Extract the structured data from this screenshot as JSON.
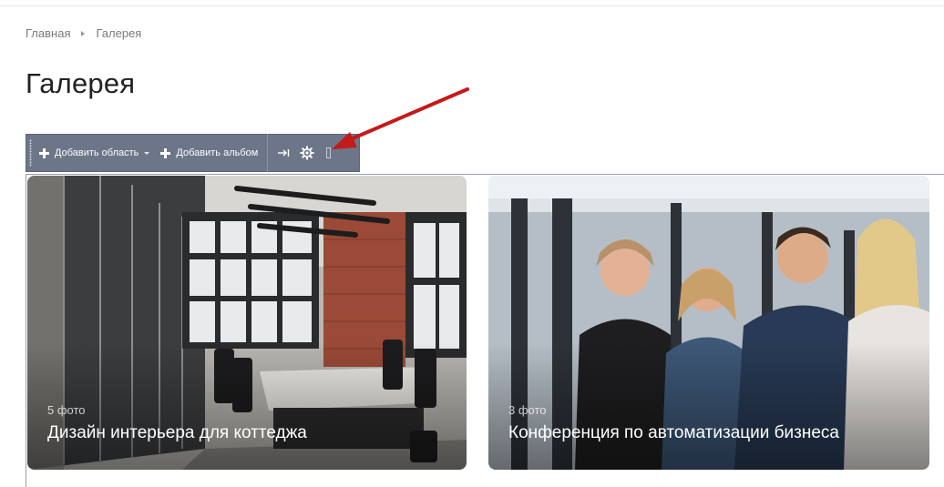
{
  "breadcrumb": {
    "items": [
      "Главная",
      "Галерея"
    ]
  },
  "page": {
    "title": "Галерея"
  },
  "toolbar": {
    "add_area_label": "Добавить область",
    "add_album_label": "Добавить альбом"
  },
  "albums": [
    {
      "count": "5 фото",
      "title": "Дизайн интерьера для коттеджа"
    },
    {
      "count": "3 фото",
      "title": "Конференция по автоматизации бизнеса"
    }
  ],
  "colors": {
    "toolbar": "#6d7689",
    "annotation_arrow": "#c41a1a"
  }
}
